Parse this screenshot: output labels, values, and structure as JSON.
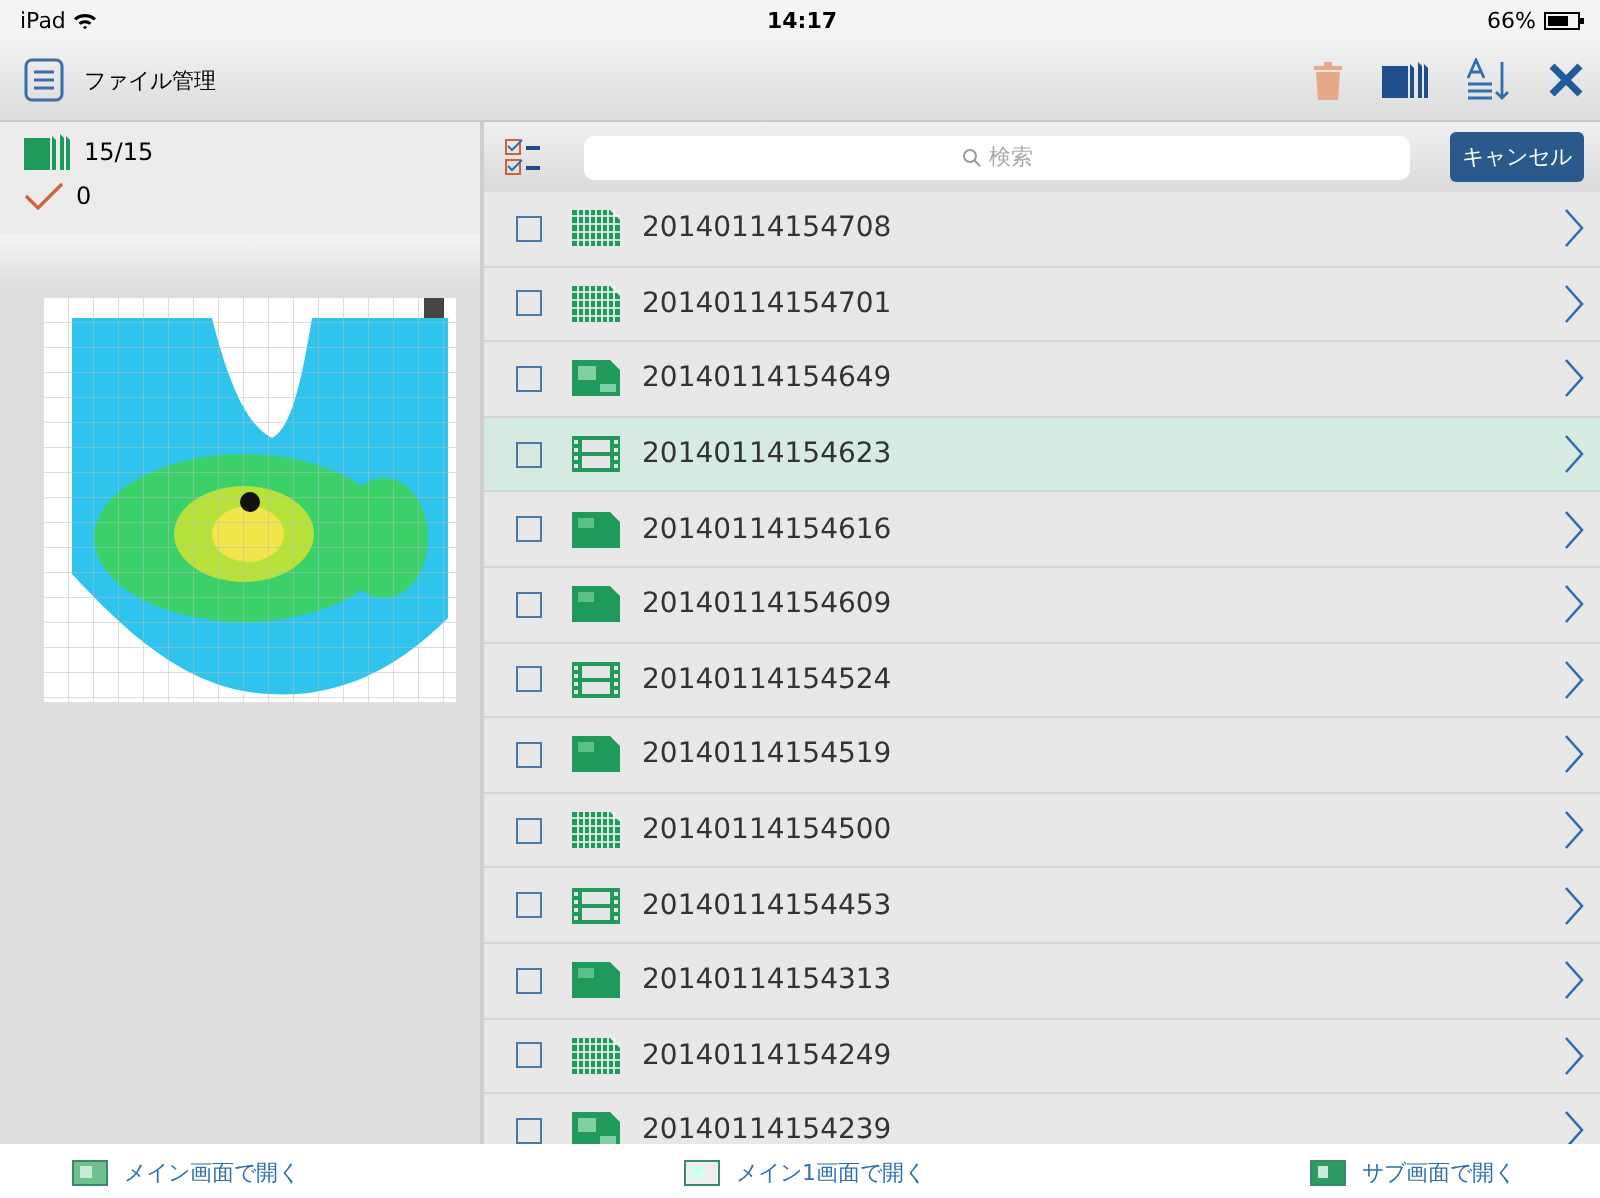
{
  "status_bar": {
    "device": "iPad",
    "time": "14:17",
    "battery": "66%"
  },
  "nav_bar": {
    "title": "ファイル管理"
  },
  "summary": {
    "file_count": "15/15",
    "checked_count": "0"
  },
  "search": {
    "placeholder": "検索",
    "cancel": "キャンセル"
  },
  "files": [
    {
      "name": "20140114154708",
      "kind": "grid",
      "checked": false,
      "selected": false
    },
    {
      "name": "20140114154701",
      "kind": "grid",
      "checked": false,
      "selected": false
    },
    {
      "name": "20140114154649",
      "kind": "jpg",
      "checked": false,
      "selected": false
    },
    {
      "name": "20140114154623",
      "kind": "film",
      "checked": false,
      "selected": true
    },
    {
      "name": "20140114154616",
      "kind": "sheet",
      "checked": false,
      "selected": false
    },
    {
      "name": "20140114154609",
      "kind": "sheet",
      "checked": false,
      "selected": false
    },
    {
      "name": "20140114154524",
      "kind": "film",
      "checked": false,
      "selected": false
    },
    {
      "name": "20140114154519",
      "kind": "sheet",
      "checked": false,
      "selected": false
    },
    {
      "name": "20140114154500",
      "kind": "grid",
      "checked": false,
      "selected": false
    },
    {
      "name": "20140114154453",
      "kind": "film",
      "checked": false,
      "selected": false
    },
    {
      "name": "20140114154313",
      "kind": "sheet",
      "checked": false,
      "selected": false
    },
    {
      "name": "20140114154249",
      "kind": "grid",
      "checked": false,
      "selected": false
    },
    {
      "name": "20140114154239",
      "kind": "jpg",
      "checked": false,
      "selected": false
    }
  ],
  "bottom_actions": [
    {
      "label": "メイン画面で開く",
      "kind": "main"
    },
    {
      "label": "メイン1画面で開く",
      "kind": "main1"
    },
    {
      "label": "サブ画面で開く",
      "kind": "sub"
    }
  ]
}
